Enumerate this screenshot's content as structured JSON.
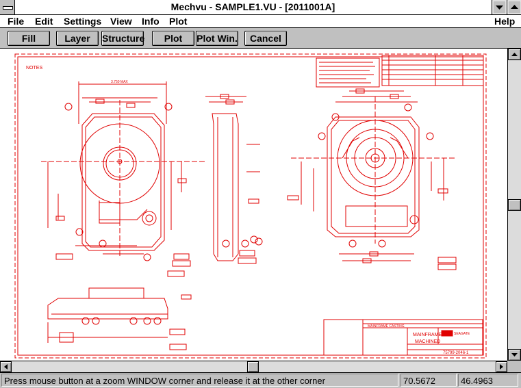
{
  "window": {
    "title": "Mechvu - SAMPLE1.VU - [2011001A]"
  },
  "menu": {
    "file": "File",
    "edit": "Edit",
    "settings": "Settings",
    "view": "View",
    "info": "Info",
    "plot": "Plot",
    "help": "Help"
  },
  "toolbar": {
    "fill": "Fill",
    "layer": "Layer",
    "structure": "Structure",
    "plot": "Plot",
    "plot_win": "Plot Win.",
    "cancel": "Cancel"
  },
  "drawing": {
    "notes_label": "NOTES",
    "dim_top": "3.750 MAX",
    "title_block": {
      "material": "MAINFRAME CASTING",
      "name_line1": "MAINFRAME",
      "name_line2": "MACHINED",
      "company": "SEAGATE",
      "drawing_no": "75799-2046-1"
    },
    "colors": {
      "line": "#e00000",
      "background": "#ffffff"
    }
  },
  "status": {
    "message": "Press mouse button at a zoom WINDOW corner and release it at the other corner",
    "x": "70.5672",
    "y": "46.4963"
  }
}
